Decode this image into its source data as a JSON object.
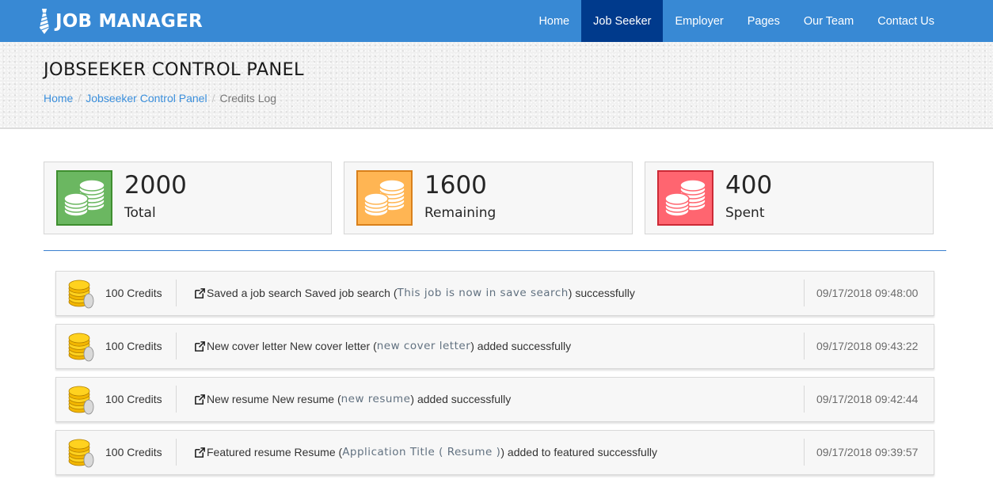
{
  "brand": {
    "name": "JOB MANAGER",
    "icon": "tie-icon"
  },
  "nav": {
    "items": [
      {
        "label": "Home",
        "active": false
      },
      {
        "label": "Job Seeker",
        "active": true
      },
      {
        "label": "Employer",
        "active": false
      },
      {
        "label": "Pages",
        "active": false
      },
      {
        "label": "Our Team",
        "active": false
      },
      {
        "label": "Contact Us",
        "active": false
      }
    ]
  },
  "header": {
    "title": "JOBSEEKER CONTROL PANEL",
    "breadcrumb": [
      {
        "label": "Home",
        "link": true
      },
      {
        "label": "Jobseeker Control Panel",
        "link": true
      },
      {
        "label": "Credits Log",
        "link": false
      }
    ],
    "separator": "/"
  },
  "stats": [
    {
      "value": "2000",
      "label": "Total",
      "icon": "coins-icon",
      "color": "#6bb761",
      "border": "#3e8e2f"
    },
    {
      "value": "1600",
      "label": "Remaining",
      "icon": "coins-icon",
      "color": "#ffb553",
      "border": "#d9801b"
    },
    {
      "value": "400",
      "label": "Spent",
      "icon": "coins-icon",
      "color": "#ff6570",
      "border": "#cc2a36"
    }
  ],
  "colors": {
    "navbar": "#3889d4",
    "nav_active": "#003a8c",
    "link": "#3b8fdc",
    "divider": "#3a7fcf"
  },
  "log": [
    {
      "credits": "100 Credits",
      "prefix": "Saved a job search Saved job search (",
      "highlight": "This job is now in save search",
      "suffix": ") successfully",
      "time": "09/17/2018 09:48:00"
    },
    {
      "credits": "100 Credits",
      "prefix": "New cover letter New cover letter (",
      "highlight": "new cover letter",
      "suffix": ") added successfully",
      "time": "09/17/2018 09:43:22"
    },
    {
      "credits": "100 Credits",
      "prefix": "New resume New resume (",
      "highlight": "new resume",
      "suffix": ") added successfully",
      "time": "09/17/2018 09:42:44"
    },
    {
      "credits": "100 Credits",
      "prefix": "Featured resume Resume (",
      "highlight": "Application Title ( Resume )",
      "suffix": ") added to featured successfully",
      "time": "09/17/2018 09:39:57"
    }
  ]
}
